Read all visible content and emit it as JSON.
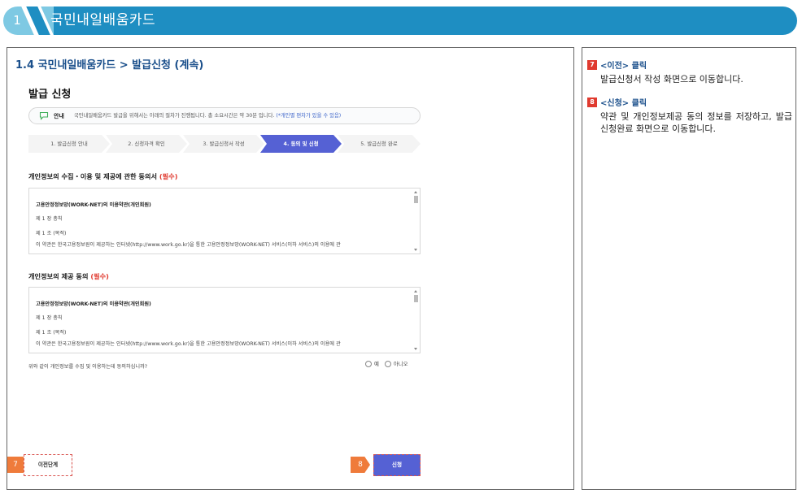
{
  "banner": {
    "number": "1",
    "title": "국민내일배움카드"
  },
  "section": {
    "title": "1.4 국민내일배움카드 > 발급신청 (계속)"
  },
  "page": {
    "heading": "발급 신청"
  },
  "notice": {
    "tag": "안내",
    "text": "국민내일배움카드 발급을 위해서는 아래의 절차가 진행됩니다. 총 소요시간은 약 30분 입니다.",
    "link": "(*개인별 편차가 있을 수 있음)"
  },
  "steps": [
    {
      "label": "1. 발급신청 안내",
      "active": false
    },
    {
      "label": "2. 신청자격 확인",
      "active": false
    },
    {
      "label": "3. 발급신청서 작성",
      "active": false
    },
    {
      "label": "4. 동의 및 신청",
      "active": true
    },
    {
      "label": "5. 발급신청 완료",
      "active": false
    }
  ],
  "consent1": {
    "title": "개인정보의 수집・이용 및 제공에 관한 동의서",
    "required": "(필수)",
    "lines": [
      "고용안정정보망(WORK-NET)의 이용약관(개인회원)",
      "제 1 장 총칙",
      "제 1 조 (목적)",
      "이 약관은 한국고용정보원이 제공하는 인터넷(http://www.work.go.kr)을 통한 고용안정정보망(WORK-NET) 서비스(이하 서비스)의 이용에 관"
    ]
  },
  "consent2": {
    "title": "개인정보의 제공 동의",
    "required": "(필수)",
    "lines": [
      "고용안정정보망(WORK-NET)의 이용약관(개인회원)",
      "제 1 장 총칙",
      "제 1 조 (목적)",
      "이 약관은 한국고용정보원이 제공하는 인터넷(http://www.work.go.kr)을 통한 고용안정정보망(WORK-NET) 서비스(이하 서비스)의 이용에 관"
    ]
  },
  "consent_question": "위와 같이 개인정보를 수집 및 이용하는데 동의하십니까?",
  "radios": {
    "yes": "예",
    "no": "아니오"
  },
  "buttons": {
    "prev": "이전단계",
    "apply": "신청"
  },
  "markers": {
    "prev": "7",
    "apply": "8"
  },
  "notes": [
    {
      "num": "7",
      "title": "<이전> 클릭",
      "desc": "발급신청서 작성 화면으로 이동합니다."
    },
    {
      "num": "8",
      "title": "<신청> 클릭",
      "desc": "약관 및 개인정보제공 동의 정보를 저장하고, 발급신청완료 화면으로 이동합니다."
    }
  ],
  "colors": {
    "banner": "#1e8ec2",
    "accent": "#5561d4",
    "marker": "#ef7b3b",
    "note_num": "#e03a2f",
    "section_title": "#1a4f8b"
  },
  "icons": {
    "notice": "speech-bubble-icon"
  }
}
